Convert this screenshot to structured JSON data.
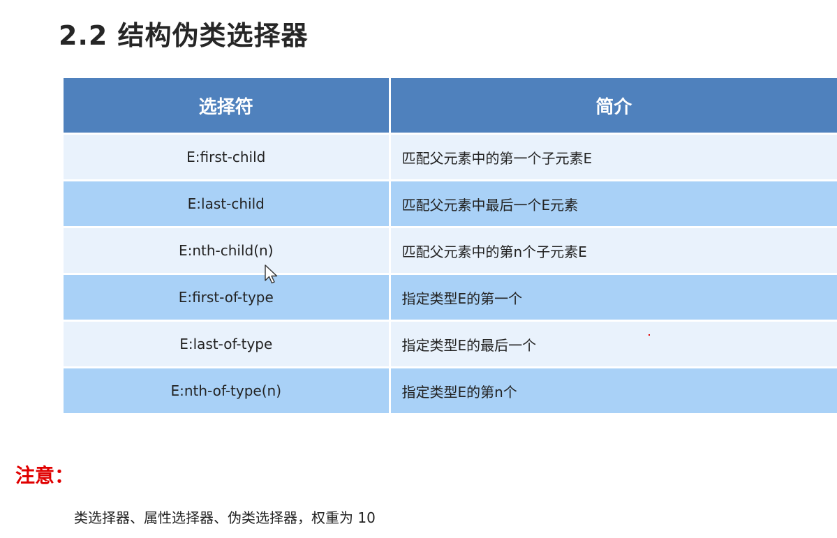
{
  "slide": {
    "title": "2.2 结构伪类选择器"
  },
  "table": {
    "headers": [
      "选择符",
      "简介"
    ],
    "rows": [
      {
        "selector": "E:first-child",
        "description": "匹配父元素中的第一个子元素E"
      },
      {
        "selector": "E:last-child",
        "description": "匹配父元素中最后一个E元素"
      },
      {
        "selector": "E:nth-child(n)",
        "description": "匹配父元素中的第n个子元素E"
      },
      {
        "selector": "E:first-of-type",
        "description": "指定类型E的第一个"
      },
      {
        "selector": "E:last-of-type",
        "description": "指定类型E的最后一个"
      },
      {
        "selector": "E:nth-of-type(n)",
        "description": "指定类型E的第n个"
      }
    ]
  },
  "note": {
    "label": "注意：",
    "text": "类选择器、属性选择器、伪类选择器，权重为 10"
  },
  "colors": {
    "header_bg": "#4f81bd",
    "row_light": "#e9f2fc",
    "row_dark": "#a9d1f7",
    "note_label": "#e00000"
  },
  "icons": {
    "cursor": "mouse-pointer-icon"
  }
}
